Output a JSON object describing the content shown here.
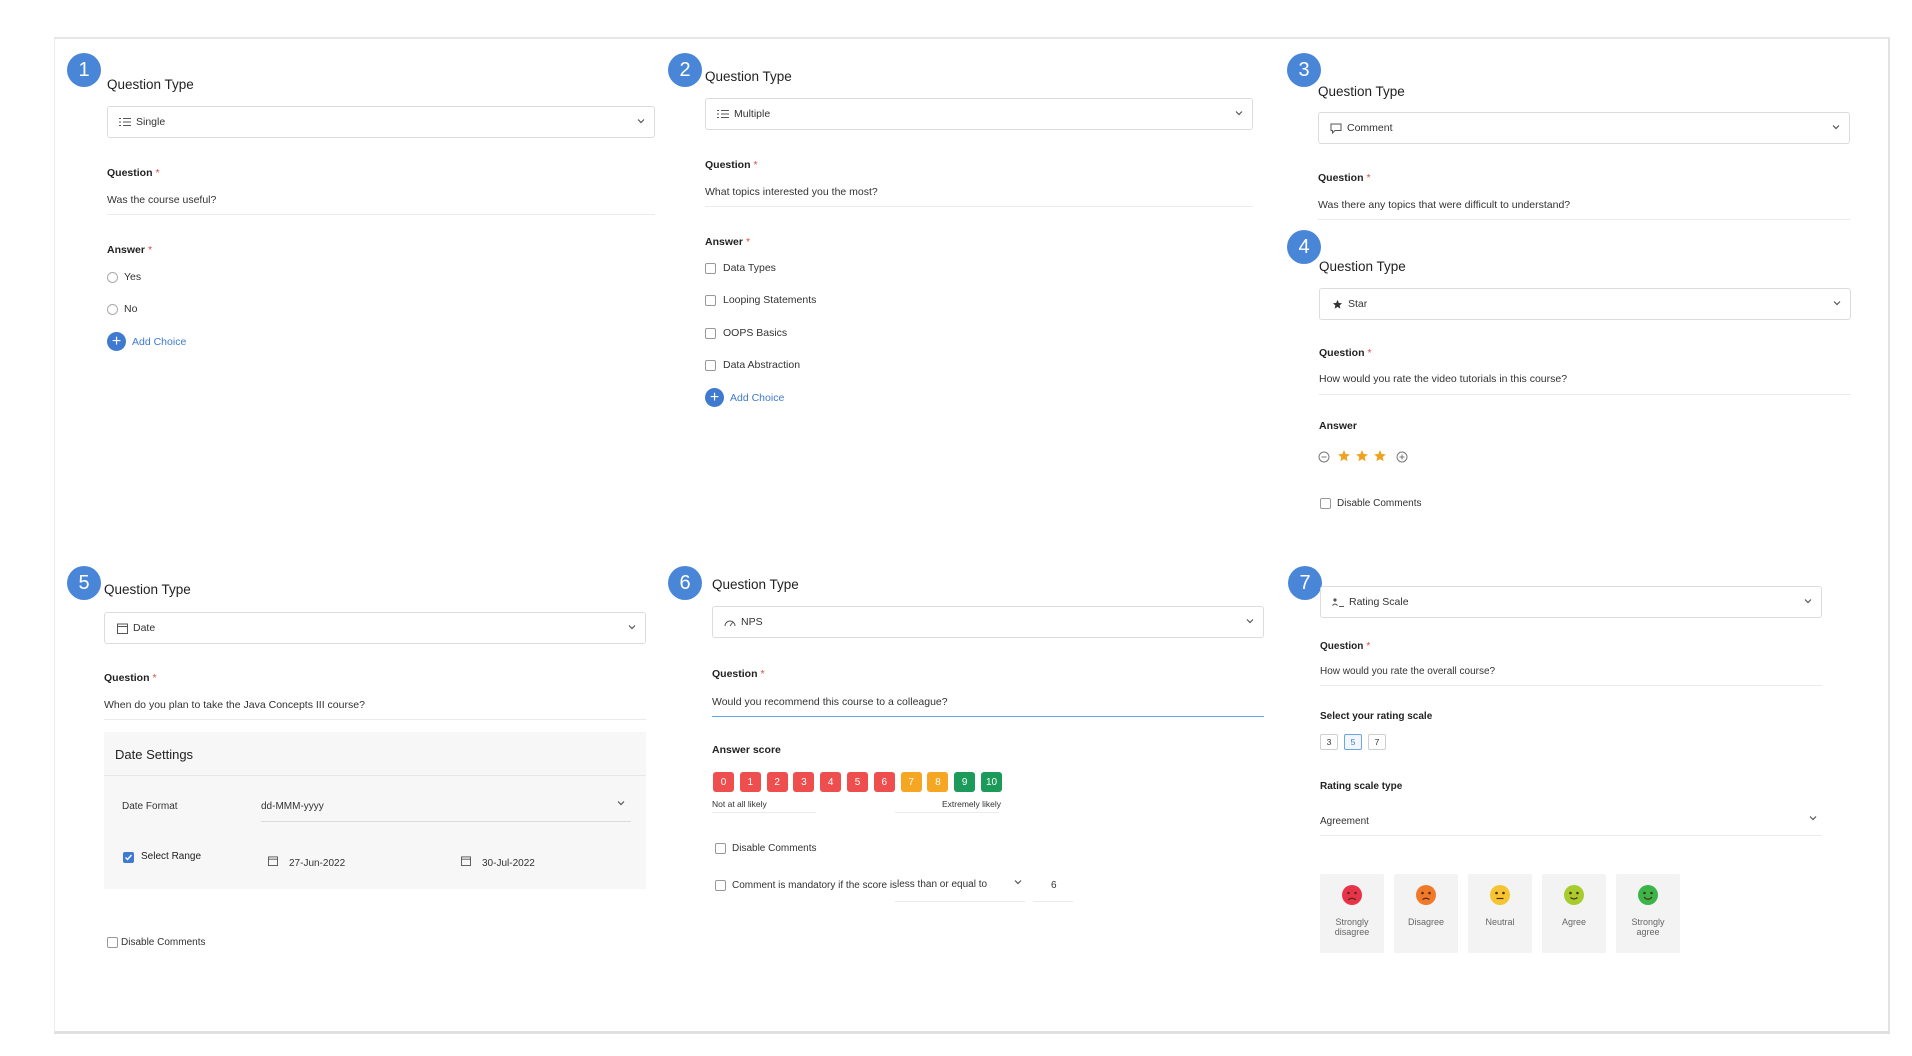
{
  "common": {
    "question_type_label": "Question Type",
    "question_label": "Question",
    "answer_label": "Answer",
    "required_mark": "*",
    "add_choice": "Add Choice",
    "disable_comments": "Disable Comments"
  },
  "badges": [
    "1",
    "2",
    "3",
    "4",
    "5",
    "6",
    "7"
  ],
  "panel1": {
    "type": "Single",
    "question": "Was the course useful?",
    "choices": [
      "Yes",
      "No"
    ]
  },
  "panel2": {
    "type": "Multiple",
    "question": "What topics interested you the most?",
    "choices": [
      "Data Types",
      "Looping Statements",
      "OOPS Basics",
      "Data Abstraction"
    ]
  },
  "panel3": {
    "type": "Comment",
    "question": "Was there any topics that were difficult to understand?"
  },
  "panel4": {
    "type": "Star",
    "question": "How would you rate the video tutorials in this course?",
    "stars": 3
  },
  "panel5": {
    "type": "Date",
    "question": "When do you plan to take the Java Concepts III course?",
    "settings_title": "Date Settings",
    "date_format_label": "Date Format",
    "date_format_value": "dd-MMM-yyyy",
    "select_range_label": "Select Range",
    "start_date": "27-Jun-2022",
    "end_date": "30-Jul-2022"
  },
  "panel6": {
    "type": "NPS",
    "question": "Would you recommend this course to a colleague?",
    "answer_score_label": "Answer score",
    "scores": [
      "0",
      "1",
      "2",
      "3",
      "4",
      "5",
      "6",
      "7",
      "8",
      "9",
      "10"
    ],
    "low_label": "Not at all likely",
    "high_label": "Extremely likely",
    "mandatory_text": "Comment is mandatory if the score is",
    "condition": "less than or equal to",
    "threshold": "6"
  },
  "panel7": {
    "type": "Rating Scale",
    "question": "How would you rate the overall course?",
    "scale_label": "Select your rating scale",
    "scale_options": [
      "3",
      "5",
      "7"
    ],
    "scale_type_label": "Rating scale type",
    "scale_type_value": "Agreement",
    "faces": [
      "Strongly disagree",
      "Disagree",
      "Neutral",
      "Agree",
      "Strongly agree"
    ]
  },
  "colors": {
    "accent": "#3f7ad0",
    "badge": "#4a86d8",
    "nps_red": "#ef4e4e",
    "nps_orange": "#f5a623",
    "nps_green": "#1b9a5a",
    "star": "#f0a21f",
    "required": "#e04848"
  }
}
